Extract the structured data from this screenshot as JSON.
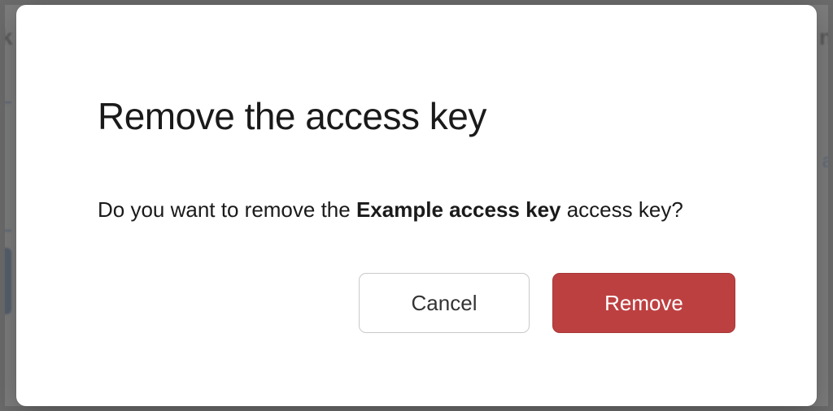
{
  "dialog": {
    "title": "Remove the access key",
    "body_prefix": "Do you want to remove the ",
    "body_name": "Example access key",
    "body_suffix": " access key?",
    "cancel_label": "Cancel",
    "confirm_label": "Remove"
  },
  "colors": {
    "danger": "#bd4041"
  }
}
